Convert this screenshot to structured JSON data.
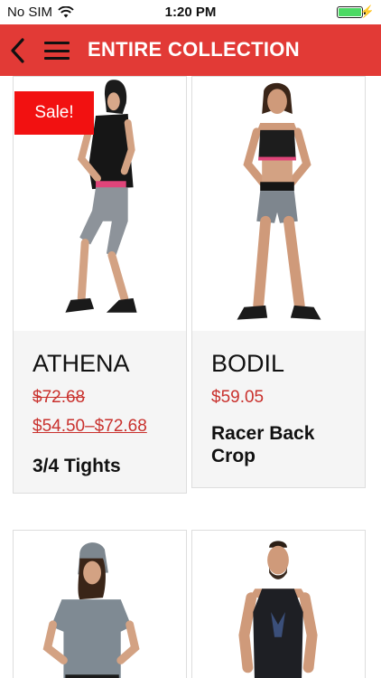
{
  "status_bar": {
    "carrier": "No SIM",
    "time": "1:20 PM",
    "battery_level": 1.0,
    "icons": [
      "wifi-icon",
      "battery-icon",
      "charging-bolt-icon"
    ]
  },
  "nav": {
    "title": "ENTIRE COLLECTION",
    "back_icon": "chevron-left-icon",
    "menu_icon": "hamburger-menu-icon",
    "background_color": "#e23a36"
  },
  "products": [
    {
      "name": "ATHENA",
      "badge": "Sale!",
      "old_price": "$72.68",
      "price_range": "$54.50–$72.68",
      "description": "3/4 Tights"
    },
    {
      "name": "BODIL",
      "price": "$59.05",
      "description": "Racer Back Crop"
    },
    {
      "name": "",
      "description": ""
    },
    {
      "name": "",
      "description": ""
    }
  ],
  "colors": {
    "accent": "#e23a36",
    "sale_badge": "#f21111",
    "price": "#c9312d"
  }
}
